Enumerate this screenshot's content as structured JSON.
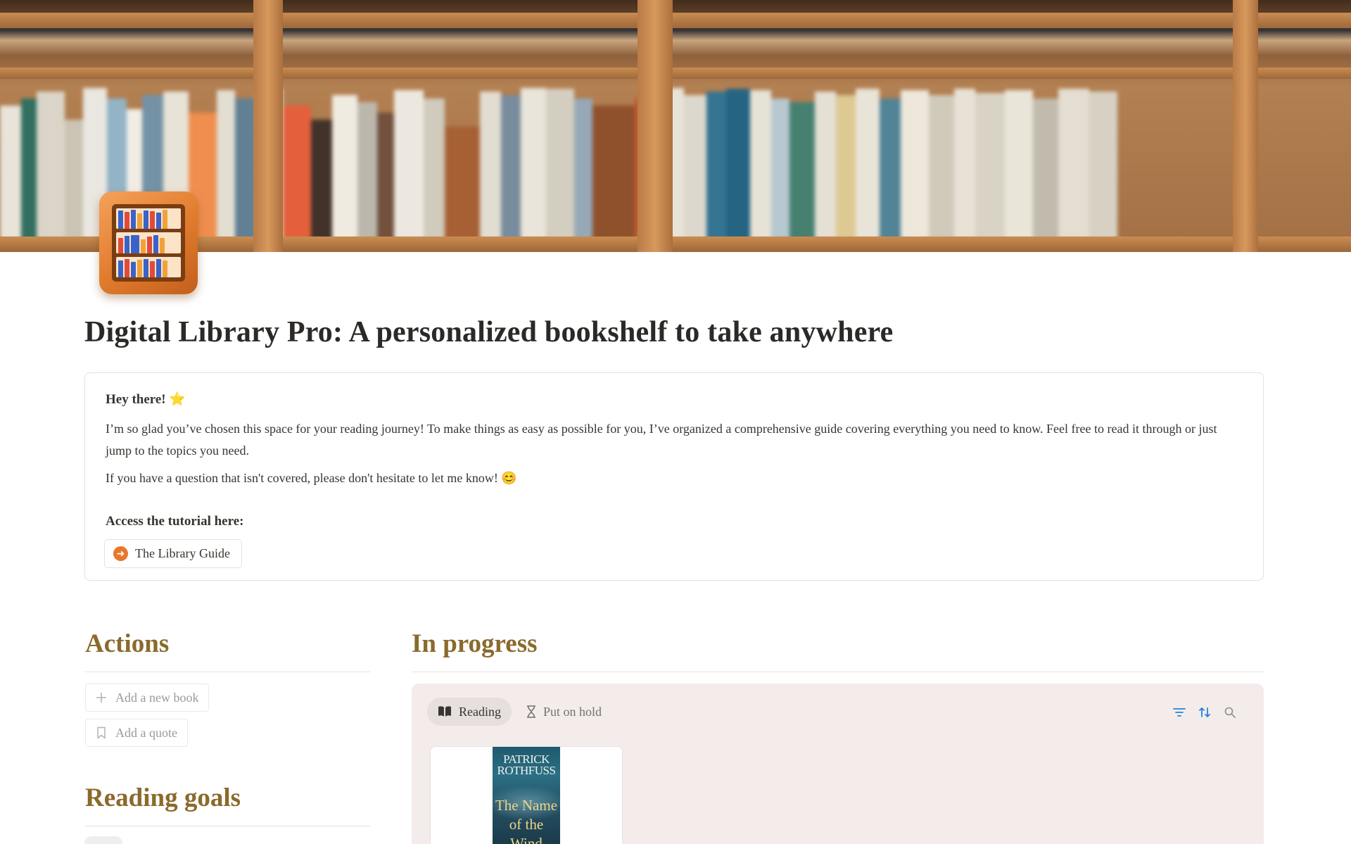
{
  "page": {
    "title": "Digital Library Pro: A personalized bookshelf to take anywhere",
    "icon": "bookshelf-icon"
  },
  "callout": {
    "greeting": "Hey there!",
    "greeting_emoji": "⭐",
    "paragraph1": "I’m so glad you’ve chosen this space for your reading journey! To make things as easy as possible for you, I’ve organized a comprehensive guide covering everything you need to know. Feel free to read it through or just jump to the topics you need.",
    "paragraph2": "If you have a question that isn't covered, please don't hesitate to let me know!",
    "paragraph2_emoji": "😊",
    "access_label": "Access the tutorial here:",
    "guide_link": "The Library Guide"
  },
  "actions": {
    "heading": "Actions",
    "add_book": "Add a new book",
    "add_quote": "Add a quote"
  },
  "reading_goals": {
    "heading": "Reading goals"
  },
  "in_progress": {
    "heading": "In progress",
    "tabs": [
      {
        "label": "Reading",
        "icon": "open-book-icon",
        "active": true
      },
      {
        "label": "Put on hold",
        "icon": "hourglass-icon",
        "active": false
      }
    ],
    "toolbar": [
      "filter-icon",
      "sort-icon",
      "search-icon"
    ],
    "cards": [
      {
        "cover_author": "PATRICK ROTHFUSS",
        "cover_title": "The Name of the Wind"
      }
    ]
  },
  "colors": {
    "heading_gold": "#8a6a2c",
    "accent_orange": "#e9762b",
    "panel_bg": "#f4ecea",
    "toolbar_blue": "#2383e2"
  }
}
